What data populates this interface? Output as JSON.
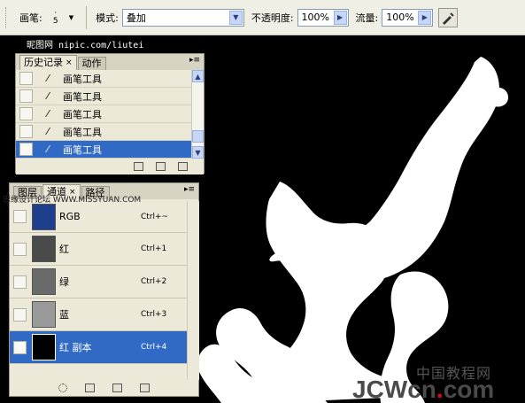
{
  "options_bar": {
    "brush_label": "画笔:",
    "brush_size": "5",
    "mode_label": "模式:",
    "mode_value": "叠加",
    "opacity_label": "不透明度:",
    "opacity_value": "100%",
    "flow_label": "流量:",
    "flow_value": "100%"
  },
  "watermarks": {
    "top_left": "昵图网 nipic.com/liutei",
    "mid_left": "思缘设计论坛 WWW.MISSYUAN.COM",
    "bottom_right_cn": "中国教程网",
    "bottom_right_en": "JCWcn",
    "bottom_right_dot": ".",
    "bottom_right_com": "com"
  },
  "history_panel": {
    "tabs": [
      "历史记录",
      "动作"
    ],
    "items": [
      {
        "label": "画笔工具"
      },
      {
        "label": "画笔工具"
      },
      {
        "label": "画笔工具"
      },
      {
        "label": "画笔工具"
      },
      {
        "label": "画笔工具"
      }
    ]
  },
  "channels_panel": {
    "tabs": [
      "图层",
      "通道",
      "路径"
    ],
    "channels": [
      {
        "name": "RGB",
        "shortcut": "Ctrl+~",
        "visible": false
      },
      {
        "name": "红",
        "shortcut": "Ctrl+1",
        "visible": false
      },
      {
        "name": "绿",
        "shortcut": "Ctrl+2",
        "visible": false
      },
      {
        "name": "蓝",
        "shortcut": "Ctrl+3",
        "visible": false
      },
      {
        "name": "红 副本",
        "shortcut": "Ctrl+4",
        "visible": true
      }
    ]
  },
  "colors": {
    "selection": "#316ac5",
    "panel_bg": "#ece9d8",
    "canvas_bg": "#000000",
    "accent_red": "#e8001c"
  },
  "icons": [
    "brush-tool-icon",
    "airbrush-icon",
    "eye-icon",
    "history-brush-icon",
    "new-snapshot-icon",
    "new-document-icon",
    "trash-icon",
    "load-selection-icon",
    "save-selection-icon",
    "new-channel-icon",
    "delete-channel-icon"
  ]
}
